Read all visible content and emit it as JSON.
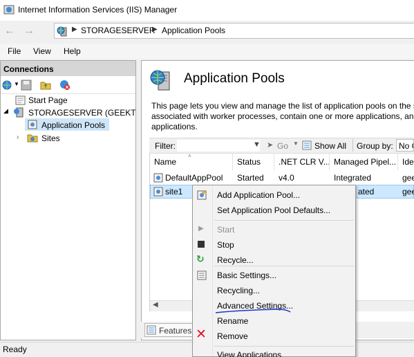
{
  "window": {
    "title": "Internet Information Services (IIS) Manager"
  },
  "address": {
    "segments": [
      "STORAGESERVER",
      "Application Pools"
    ],
    "sep": "▶"
  },
  "menu": {
    "file": "File",
    "view": "View",
    "help": "Help"
  },
  "connections": {
    "header": "Connections",
    "tree": {
      "start_page": "Start Page",
      "server": "STORAGESERVER (GEEKTOOD",
      "app_pools": "Application Pools",
      "sites": "Sites"
    }
  },
  "main": {
    "title": "Application Pools",
    "description_lines": [
      "This page lets you view and manage the list of application pools on the s",
      "associated with worker processes, contain one or more applications, and",
      "applications."
    ],
    "filter": {
      "label": "Filter:",
      "go": "Go",
      "show_all": "Show All",
      "group_by": "Group by:",
      "group_value": "No G"
    },
    "columns": [
      "Name",
      "Status",
      ".NET CLR V...",
      "Managed Pipel...",
      "Ide"
    ],
    "rows": [
      {
        "name": "DefaultAppPool",
        "status": "Started",
        "clr": "v4.0",
        "pipeline": "Integrated",
        "identity": "gee"
      },
      {
        "name": "site1",
        "status": "",
        "clr": "",
        "pipeline": "ated",
        "identity": "gee"
      }
    ],
    "tabs": {
      "features": "Features"
    }
  },
  "status": {
    "text": "Ready"
  },
  "context_menu": {
    "items": [
      {
        "label": "Add Application Pool...",
        "icon": "app-pool-icon",
        "enabled": true
      },
      {
        "label": "Set Application Pool Defaults...",
        "icon": "",
        "enabled": true
      },
      {
        "label": "Start",
        "icon": "play-icon",
        "enabled": false
      },
      {
        "label": "Stop",
        "icon": "stop-icon",
        "enabled": true
      },
      {
        "label": "Recycle...",
        "icon": "recycle-icon",
        "enabled": true
      },
      {
        "label": "Basic Settings...",
        "icon": "settings-icon",
        "enabled": true
      },
      {
        "label": "Recycling...",
        "icon": "",
        "enabled": true
      },
      {
        "label": "Advanced Settings...",
        "icon": "",
        "enabled": true
      },
      {
        "label": "Rename",
        "icon": "",
        "enabled": true
      },
      {
        "label": "Remove",
        "icon": "remove-icon",
        "enabled": true
      },
      {
        "label": "View Applications",
        "icon": "",
        "enabled": true
      }
    ]
  },
  "colors": {
    "selection": "#cce8ff",
    "remove": "#e81123",
    "recycle": "#2e9e3a",
    "annotation": "#1a33cc"
  }
}
